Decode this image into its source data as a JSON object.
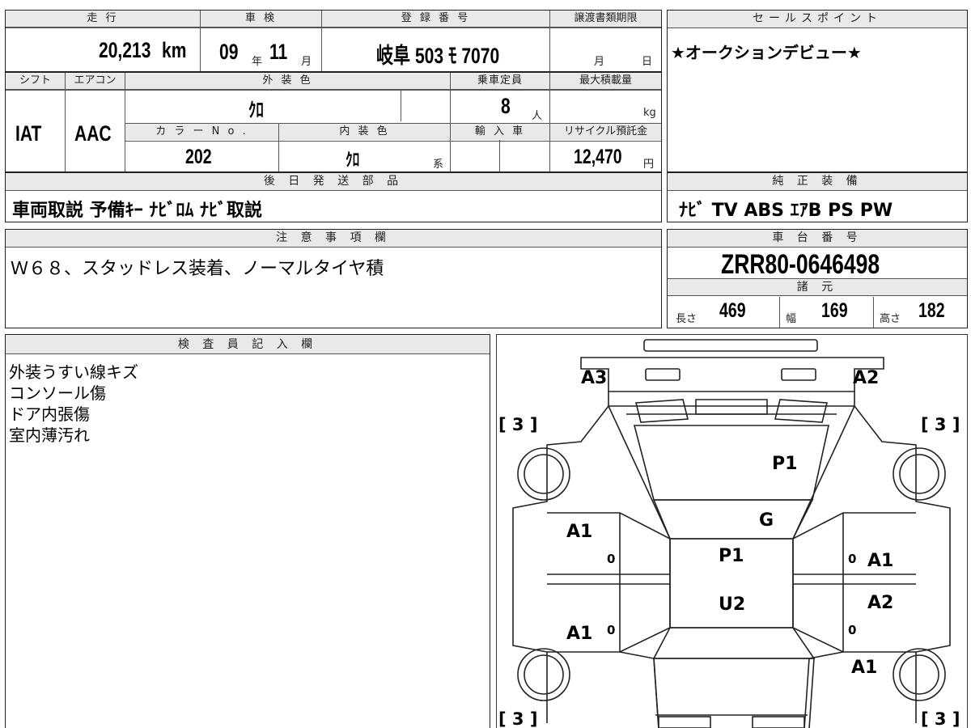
{
  "top": {
    "mileage_label": "走 行",
    "mileage_value": "20,213",
    "mileage_unit": "km",
    "shaken_label": "車 検",
    "shaken_year": "09",
    "shaken_year_unit": "年",
    "shaken_month": "11",
    "shaken_month_unit": "月",
    "plate_label": "登 録 番 号",
    "plate_value": "岐阜 503 ﾓ 7070",
    "transfer_label": "譲渡書類期限",
    "transfer_month": "月",
    "transfer_day": "日"
  },
  "row2": {
    "shift_label": "シフト",
    "shift_value": "IAT",
    "ac_label": "エアコン",
    "ac_value": "AAC",
    "ext_color_label": "外 装 色",
    "ext_color_value": "ｸﾛ",
    "capacity_label": "乗車定員",
    "capacity_value": "8",
    "capacity_unit": "人",
    "load_label": "最大積載量",
    "load_unit": "kg",
    "color_no_label": "カ ラ ー N o .",
    "color_no_value": "202",
    "int_color_label": "内 装 色",
    "int_color_value": "ｸﾛ",
    "int_color_suffix": "系",
    "import_label": "輸 入 車",
    "recycle_label": "リサイクル預託金",
    "recycle_value": "12,470",
    "recycle_unit": "円"
  },
  "later": {
    "label": "後 日 発 送 部 品",
    "value": "車両取説 予備ｷｰ ﾅﾋﾞﾛﾑ ﾅﾋﾞ取説"
  },
  "sales": {
    "label": "セールスポイント",
    "value": "★オークションデビュー★"
  },
  "equipment": {
    "label": "純 正 装 備",
    "value": "ﾅﾋﾞ TV ABS ｴｱB PS PW"
  },
  "notes": {
    "label": "注 意 事 項 欄",
    "value": "Ｗ６８、スタッドレス装着、ノーマルタイヤ積"
  },
  "chassis": {
    "label": "車 台 番 号",
    "value": "ZRR80-0646498"
  },
  "specs": {
    "label": "諸 元",
    "length_label": "長さ",
    "length_value": "469",
    "width_label": "幅",
    "width_value": "169",
    "height_label": "高さ",
    "height_value": "182"
  },
  "inspector": {
    "label": "検 査 員 記 入 欄",
    "lines": [
      "外装うすい線キズ",
      "コンソール傷",
      "ドア内張傷",
      "室内薄汚れ"
    ]
  },
  "diagram": {
    "marks": {
      "rear_left": "A3",
      "rear_right": "A2",
      "tire_tl": "[ 3 ]",
      "tire_tr": "[ 3 ]",
      "tire_bl": "[ 3 ]",
      "tire_br": "[ 3 ]",
      "rear_glass": "P1",
      "roof_glass": "G",
      "left_rear_door": "A1",
      "left_front_door": "A1",
      "roof": "P1",
      "hood": "U2",
      "right_rear_door": "A1",
      "right_front_door": "A2",
      "right_fender": "A1",
      "zero_1": "0",
      "zero_2": "0",
      "zero_3": "0",
      "zero_4": "0"
    }
  }
}
